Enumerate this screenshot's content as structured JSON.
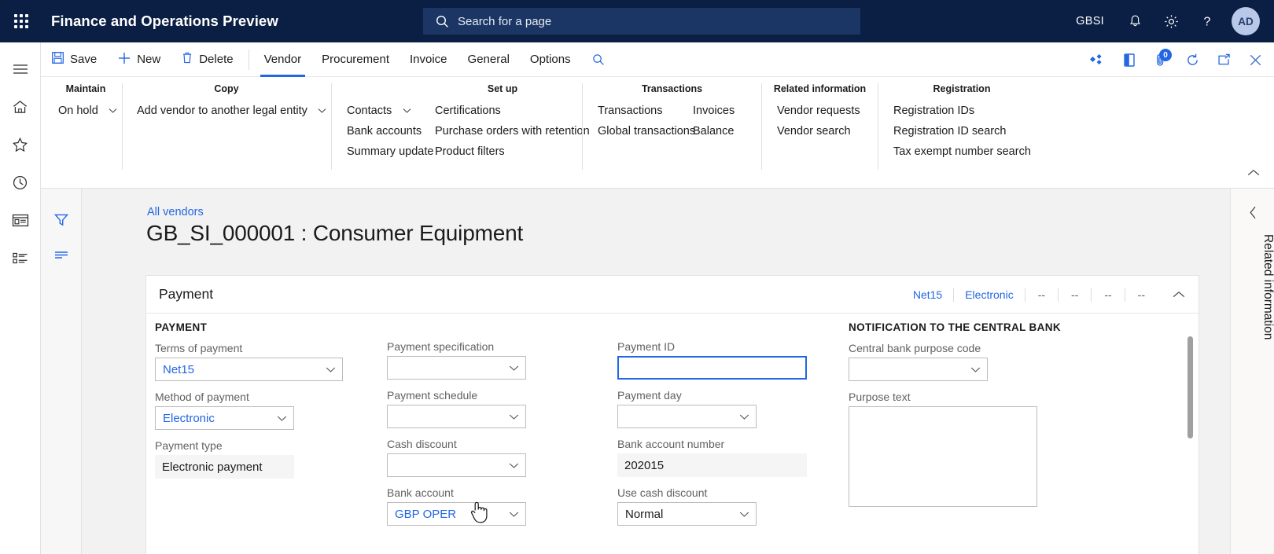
{
  "topbar": {
    "waffle_icon": "app-launcher-icon",
    "app_title": "Finance and Operations Preview",
    "search": {
      "placeholder": "Search for a page",
      "icon": "search-icon"
    },
    "company": "GBSI",
    "icons": [
      "notification-bell-icon",
      "gear-icon",
      "help-question-icon"
    ],
    "avatar_initials": "AD"
  },
  "leftrail": {
    "items": [
      {
        "name": "hamburger-menu-icon"
      },
      {
        "name": "home-icon"
      },
      {
        "name": "favorites-star-icon"
      },
      {
        "name": "recent-clock-icon"
      },
      {
        "name": "workspaces-icon"
      },
      {
        "name": "modules-list-icon"
      }
    ]
  },
  "commandbar": {
    "buttons": [
      {
        "label": "Save",
        "icon": "save-disk-icon"
      },
      {
        "label": "New",
        "icon": "plus-icon"
      },
      {
        "label": "Delete",
        "icon": "trash-icon"
      }
    ],
    "tabs": [
      {
        "label": "Vendor",
        "active": true
      },
      {
        "label": "Procurement",
        "active": false
      },
      {
        "label": "Invoice",
        "active": false
      },
      {
        "label": "General",
        "active": false
      },
      {
        "label": "Options",
        "active": false
      }
    ],
    "search_icon": "search-icon",
    "right_icons": [
      {
        "name": "share-diamonds-icon"
      },
      {
        "name": "office-app-icon"
      },
      {
        "name": "attachment-icon",
        "badge": "0"
      },
      {
        "name": "refresh-icon"
      },
      {
        "name": "popout-icon"
      },
      {
        "name": "close-icon"
      }
    ]
  },
  "ribbon": {
    "groups": [
      {
        "title": "Maintain",
        "columns": [
          [
            {
              "label": "On hold",
              "dropdown": true
            }
          ]
        ]
      },
      {
        "title": "Copy",
        "columns": [
          [
            {
              "label": "Add vendor to another legal entity",
              "dropdown": true
            }
          ]
        ]
      },
      {
        "title": "Set up",
        "columns": [
          [
            {
              "label": "Contacts",
              "dropdown": true
            },
            {
              "label": "Bank accounts",
              "dropdown": false
            },
            {
              "label": "Summary update",
              "dropdown": false
            }
          ],
          [
            {
              "label": "Certifications",
              "dropdown": false
            },
            {
              "label": "Purchase orders with retention",
              "dropdown": false
            },
            {
              "label": "Product filters",
              "dropdown": false
            }
          ]
        ]
      },
      {
        "title": "Transactions",
        "columns": [
          [
            {
              "label": "Transactions",
              "dropdown": false
            },
            {
              "label": "Global transactions",
              "dropdown": false
            }
          ],
          [
            {
              "label": "Invoices",
              "dropdown": false
            },
            {
              "label": "Balance",
              "dropdown": false
            }
          ]
        ]
      },
      {
        "title": "Related information",
        "columns": [
          [
            {
              "label": "Vendor requests",
              "dropdown": false
            },
            {
              "label": "Vendor search",
              "dropdown": false
            }
          ]
        ]
      },
      {
        "title": "Registration",
        "columns": [
          [
            {
              "label": "Registration IDs",
              "dropdown": false
            },
            {
              "label": "Registration ID search",
              "dropdown": false
            },
            {
              "label": "Tax exempt number search",
              "dropdown": false
            }
          ]
        ]
      }
    ],
    "collapse_icon": "chevron-up-icon"
  },
  "filterrail": {
    "items": [
      {
        "name": "filter-funnel-icon"
      },
      {
        "name": "list-lines-icon"
      }
    ]
  },
  "page": {
    "breadcrumb": "All vendors",
    "title": "GB_SI_000001 : Consumer Equipment"
  },
  "section": {
    "title": "Payment",
    "summary": [
      {
        "text": "Net15",
        "link": true
      },
      {
        "text": "Electronic",
        "link": true
      },
      {
        "text": "--",
        "link": false
      },
      {
        "text": "--",
        "link": false
      },
      {
        "text": "--",
        "link": false
      },
      {
        "text": "--",
        "link": false
      }
    ],
    "collapse_icon": "chevron-up-icon"
  },
  "form": {
    "col1": {
      "heading": "PAYMENT",
      "fields": [
        {
          "label": "Terms of payment",
          "value": "Net15",
          "type": "combo",
          "link": true
        },
        {
          "label": "Method of payment",
          "value": "Electronic",
          "type": "combo",
          "link": true
        },
        {
          "label": "Payment type",
          "value": "Electronic payment",
          "type": "readonly",
          "link": false
        }
      ]
    },
    "col2": {
      "heading": "",
      "fields": [
        {
          "label": "Payment specification",
          "value": "",
          "type": "combo",
          "link": false
        },
        {
          "label": "Payment schedule",
          "value": "",
          "type": "combo",
          "link": false
        },
        {
          "label": "Cash discount",
          "value": "",
          "type": "combo",
          "link": false
        },
        {
          "label": "Bank account",
          "value": "GBP OPER",
          "type": "combo",
          "link": true
        }
      ]
    },
    "col3": {
      "heading": "",
      "fields": [
        {
          "label": "Payment ID",
          "value": "",
          "type": "text-focused",
          "link": false
        },
        {
          "label": "Payment day",
          "value": "",
          "type": "combo",
          "link": false
        },
        {
          "label": "Bank account number",
          "value": "202015",
          "type": "readonly",
          "link": false
        },
        {
          "label": "Use cash discount",
          "value": "Normal",
          "type": "combo",
          "link": false
        }
      ]
    },
    "col4": {
      "heading": "NOTIFICATION TO THE CENTRAL BANK",
      "fields": [
        {
          "label": "Central bank purpose code",
          "value": "",
          "type": "combo",
          "link": false
        },
        {
          "label": "Purpose text",
          "value": "",
          "type": "textarea",
          "link": false
        }
      ]
    }
  },
  "relatedpanel": {
    "collapse_icon": "chevron-left-icon",
    "label": "Related information"
  },
  "colors": {
    "nav_bg": "#0b1f44",
    "accent": "#2266e3",
    "search_bg": "#1b3664",
    "workspace_bg": "#f2f2f2"
  }
}
